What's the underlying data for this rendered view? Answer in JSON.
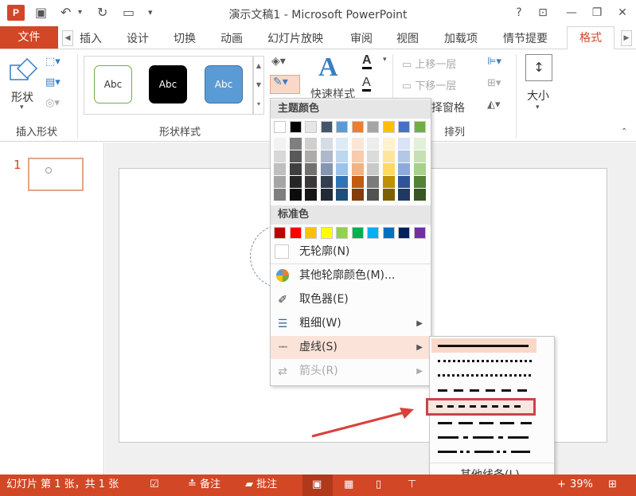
{
  "titlebar": {
    "logo": "P",
    "title": "演示文稿1 - Microsoft PowerPoint",
    "help": "?"
  },
  "tabs": {
    "file": "文件",
    "items": [
      "插入",
      "设计",
      "切换",
      "动画",
      "幻灯片放映",
      "审阅",
      "视图",
      "加载项",
      "情节提要"
    ],
    "active": "格式"
  },
  "ribbon": {
    "shapes_btn": "形状",
    "insert_shapes_label": "插入形状",
    "styles": [
      {
        "text": "Abc",
        "bg": "#ffffff",
        "border": "#70ad47",
        "color": "#333333"
      },
      {
        "text": "Abc",
        "bg": "#000000",
        "border": "#000000",
        "color": "#ffffff"
      },
      {
        "text": "Abc",
        "bg": "#5b9bd5",
        "border": "#41719c",
        "color": "#ffffff"
      }
    ],
    "shape_styles_label": "形状样式",
    "quick_styles": "快速样式",
    "bring_forward": "上移一层",
    "send_backward": "下移一层",
    "selection_pane": "择窗格",
    "arrange_label": "排列",
    "size_btn": "大小"
  },
  "slides": {
    "number": "1"
  },
  "outline_menu": {
    "theme_colors_header": "主题颜色",
    "theme_top": [
      "#ffffff",
      "#000000",
      "#e7e6e6",
      "#44546a",
      "#5b9bd5",
      "#ed7d31",
      "#a5a5a5",
      "#ffc000",
      "#4472c4",
      "#70ad47"
    ],
    "theme_shades": [
      [
        "#f2f2f2",
        "#7f7f7f",
        "#d0cece",
        "#d6dce4",
        "#deebf6",
        "#fbe5d5",
        "#ededed",
        "#fff2cc",
        "#dae3f3",
        "#e2efd9"
      ],
      [
        "#d8d8d8",
        "#595959",
        "#aeabab",
        "#adb9ca",
        "#bdd7ee",
        "#f7cbac",
        "#dbdbdb",
        "#fee599",
        "#b4c7e7",
        "#c5e0b3"
      ],
      [
        "#bfbfbf",
        "#3f3f3f",
        "#757070",
        "#8496b0",
        "#9dc3e6",
        "#f4b183",
        "#c9c9c9",
        "#ffd966",
        "#8eaadb",
        "#a8d08d"
      ],
      [
        "#a5a5a5",
        "#262626",
        "#3a3838",
        "#323f4f",
        "#2e75b5",
        "#c55a11",
        "#7b7b7b",
        "#bf9000",
        "#2f5496",
        "#538135"
      ],
      [
        "#7f7f7f",
        "#0c0c0c",
        "#171616",
        "#222a35",
        "#1e4e79",
        "#843c0b",
        "#525252",
        "#7f6000",
        "#203864",
        "#375623"
      ]
    ],
    "standard_header": "标准色",
    "standard": [
      "#c00000",
      "#ff0000",
      "#ffc000",
      "#ffff00",
      "#92d050",
      "#00b050",
      "#00b0f0",
      "#0070c0",
      "#002060",
      "#7030a0"
    ],
    "no_outline": "无轮廓(N)",
    "more_colors": "其他轮廓颜色(M)...",
    "eyedropper": "取色器(E)",
    "weight": "粗细(W)",
    "dashes": "虚线(S)",
    "arrows": "箭头(R)"
  },
  "dash_menu": {
    "more_lines": "其他线条(L)..."
  },
  "statusbar": {
    "slide_info": "幻灯片 第 1 张，共 1 张",
    "notes": "备注",
    "comments": "批注",
    "zoom": "39%"
  },
  "accent": "#d24726"
}
